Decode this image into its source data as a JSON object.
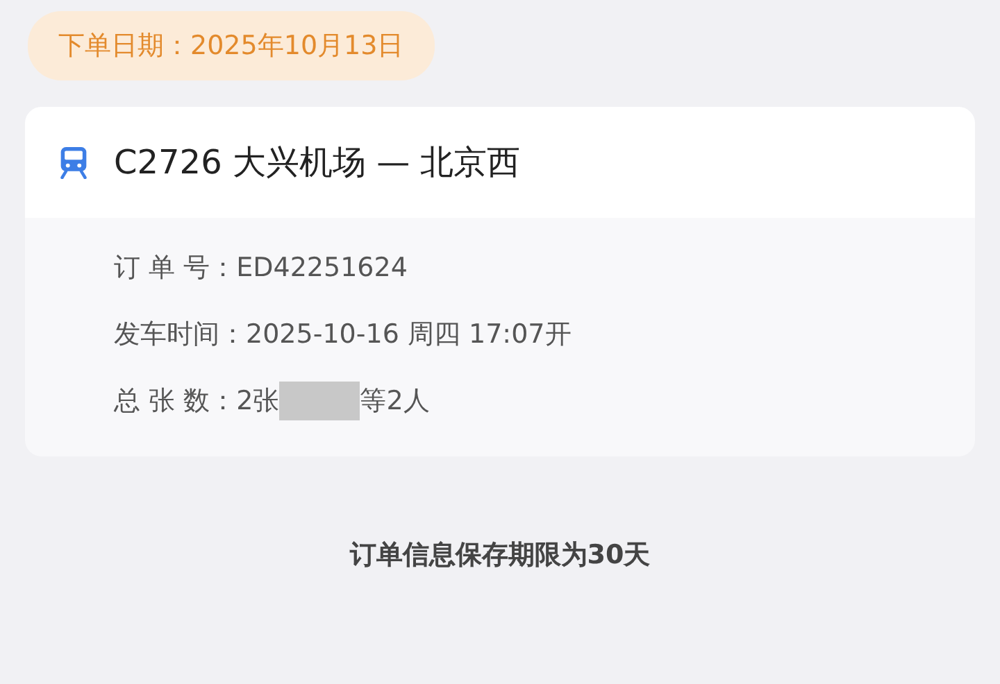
{
  "order_date": "下单日期：2025年10月13日",
  "train": {
    "title": "C2726  大兴机场 — 北京西"
  },
  "details": [
    {
      "label": "订 单 号：",
      "value": "ED42251624"
    },
    {
      "label": "发车时间：",
      "value": "2025-10-16  周四  17:07开"
    },
    {
      "label": "总 张 数：",
      "value": "2张",
      "redacted": true,
      "suffix": "等2人"
    }
  ],
  "footer_note": "订单信息保存期限为30天"
}
